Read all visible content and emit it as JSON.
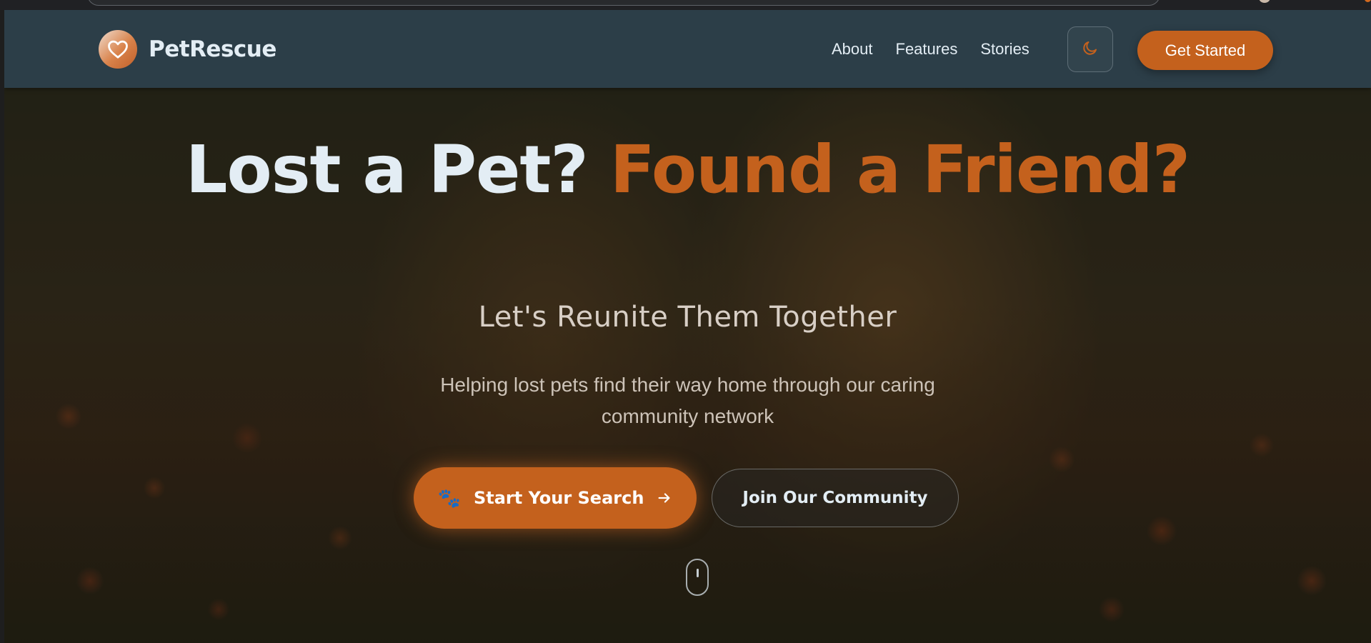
{
  "brand": {
    "name": "PetRescue",
    "logo_icon": "heart-icon"
  },
  "nav": {
    "links": [
      "About",
      "Features",
      "Stories"
    ],
    "theme_toggle_icon": "moon-icon",
    "cta_label": "Get Started"
  },
  "hero": {
    "title_main": "Lost a Pet?",
    "title_accent": "Found a Friend?",
    "subtitle": "Let's Reunite Them Together",
    "description": "Helping lost pets find their way home through our caring community network",
    "primary_button": {
      "icon": "paw-icon",
      "label": "Start Your Search",
      "trailing_icon": "arrow-right-icon"
    },
    "secondary_button_label": "Join Our Community",
    "scroll_indicator_icon": "mouse-scroll-icon"
  },
  "colors": {
    "navbar_bg": "#2c3e48",
    "accent": "#c4611d",
    "text_light": "#e3edf4"
  }
}
